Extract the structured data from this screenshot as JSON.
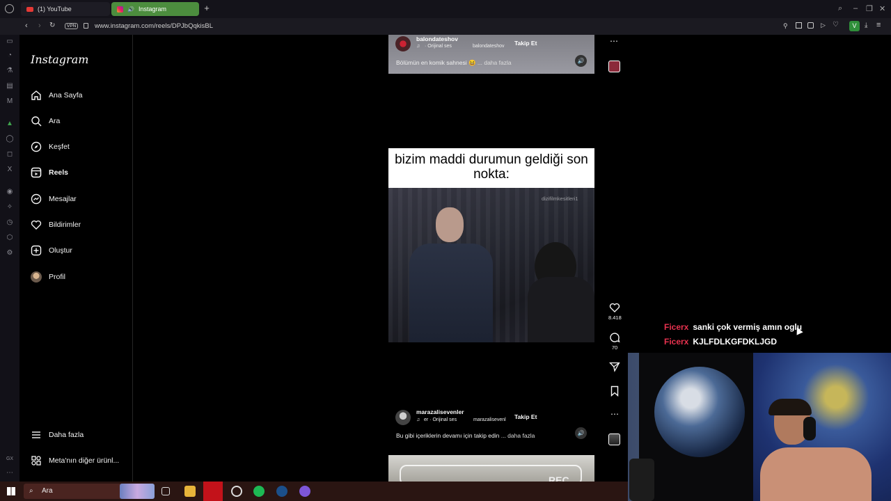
{
  "browser": {
    "tabs": [
      {
        "label": "(1) YouTube"
      },
      {
        "label": "Instagram"
      }
    ],
    "url": "www.instagram.com/reels/DPJbQqkisBL",
    "vpn_label": "VPN",
    "profile_initial": "V"
  },
  "instagram": {
    "logo": "Instagram",
    "nav": [
      {
        "label": "Ana Sayfa",
        "icon": "home-icon"
      },
      {
        "label": "Ara",
        "icon": "search-icon"
      },
      {
        "label": "Keşfet",
        "icon": "compass-icon"
      },
      {
        "label": "Reels",
        "icon": "reels-icon"
      },
      {
        "label": "Mesajlar",
        "icon": "messenger-icon"
      },
      {
        "label": "Bildirimler",
        "icon": "heart-icon"
      },
      {
        "label": "Oluştur",
        "icon": "plus-icon"
      },
      {
        "label": "Profil",
        "icon": "avatar"
      }
    ],
    "more": "Daha fazla",
    "meta": "Meta'nın diğer ürünl..."
  },
  "reel_prev": {
    "author": "balondateshov",
    "audio": "· Orijinal ses",
    "audio_author": "balondateshov",
    "follow": "Takip Et",
    "caption": "Bölümün en komik sahnesi 😆",
    "more": "... daha fazla"
  },
  "reel_current": {
    "overlay_text": "bizim maddi durumun geldiği son nokta:",
    "watermark": "dizifilmkesitleri1",
    "likes": "8.418",
    "comments": "70",
    "author": "marazalisevenler",
    "audio": "er · Orijinal ses",
    "audio_author": "marazalisevenl",
    "follow": "Takip Et",
    "caption": "Bu gibi içeriklerin devamı için takip edin",
    "more": "... daha fazla"
  },
  "reel_next": {
    "overlay_text": "REC"
  },
  "chat": [
    {
      "user": "Ficerx",
      "message": "sanki çok vermiş amın oglu"
    },
    {
      "user": "Ficerx",
      "message": "KJLFDLKGFDKLJGD"
    }
  ],
  "taskbar": {
    "search_placeholder": "Ara"
  },
  "colors": {
    "ig_tab": "#4c8d3e",
    "chat_user": "#e8324f",
    "taskbar": "#2a1512"
  }
}
